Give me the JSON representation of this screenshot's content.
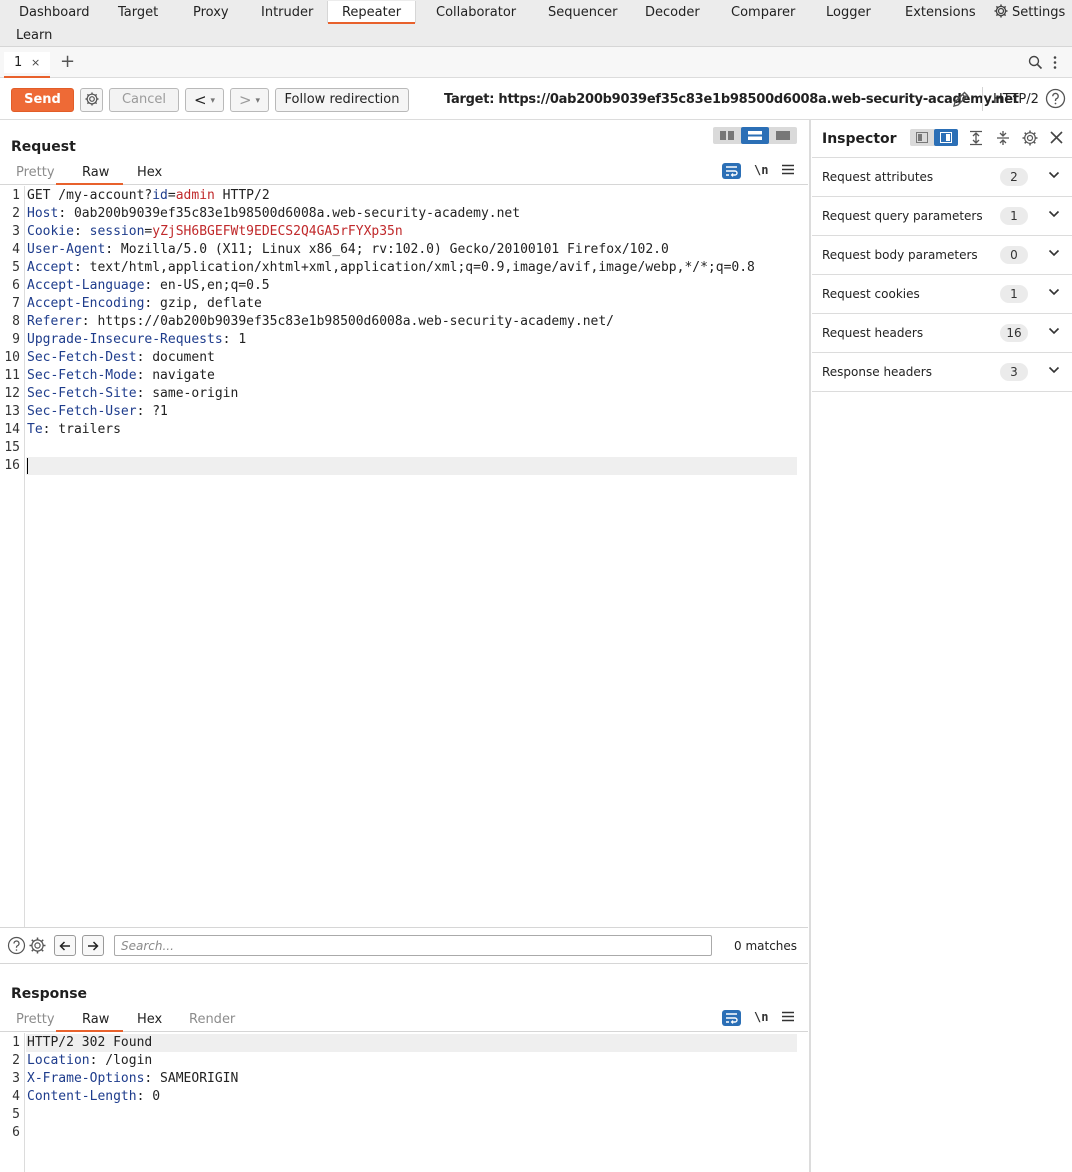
{
  "topnav": {
    "items": [
      "Dashboard",
      "Target",
      "Proxy",
      "Intruder",
      "Repeater",
      "Collaborator",
      "Sequencer",
      "Decoder",
      "Comparer",
      "Logger",
      "Extensions"
    ],
    "active": "Repeater",
    "settings_label": "Settings",
    "learn_label": "Learn",
    "accent_color": "#e8612c"
  },
  "tabs": {
    "items": [
      {
        "label": "1",
        "close": "×"
      }
    ],
    "add_label": "+"
  },
  "toolbar": {
    "send_label": "Send",
    "cancel_label": "Cancel",
    "back_label": "<",
    "forward_label": ">",
    "dropdown_glyph": "▾",
    "follow_label": "Follow redirection",
    "target_label": "Target: https://0ab200b9039ef35c83e1b98500d6008a.web-security-academy.net",
    "http_version": "HTTP/2",
    "send_color": "#ee6a36"
  },
  "request": {
    "title": "Request",
    "tabs": [
      "Pretty",
      "Raw",
      "Hex"
    ],
    "active_tab": "Raw",
    "newline_label": "\\n",
    "lines": [
      [
        {
          "t": "GET /my-account?"
        },
        {
          "t": "id",
          "c": "pk"
        },
        {
          "t": "="
        },
        {
          "t": "admin",
          "c": "pv"
        },
        {
          "t": " HTTP/2"
        }
      ],
      [
        {
          "t": "Host",
          "c": "hk"
        },
        {
          "t": ": 0ab200b9039ef35c83e1b98500d6008a.web-security-academy.net"
        }
      ],
      [
        {
          "t": "Cookie",
          "c": "hk"
        },
        {
          "t": ": "
        },
        {
          "t": "session",
          "c": "pk"
        },
        {
          "t": "="
        },
        {
          "t": "yZjSH6BGEFWt9EDECS2Q4GA5rFYXp35n",
          "c": "pv"
        }
      ],
      [
        {
          "t": "User-Agent",
          "c": "hk"
        },
        {
          "t": ": Mozilla/5.0 (X11; Linux x86_64; rv:102.0) Gecko/20100101 Firefox/102.0"
        }
      ],
      [
        {
          "t": "Accept",
          "c": "hk"
        },
        {
          "t": ": text/html,application/xhtml+xml,application/xml;q=0.9,image/avif,image/webp,*/*;q=0.8"
        }
      ],
      [
        {
          "t": "Accept-Language",
          "c": "hk"
        },
        {
          "t": ": en-US,en;q=0.5"
        }
      ],
      [
        {
          "t": "Accept-Encoding",
          "c": "hk"
        },
        {
          "t": ": gzip, deflate"
        }
      ],
      [
        {
          "t": "Referer",
          "c": "hk"
        },
        {
          "t": ": https://0ab200b9039ef35c83e1b98500d6008a.web-security-academy.net/"
        }
      ],
      [
        {
          "t": "Upgrade-Insecure-Requests",
          "c": "hk"
        },
        {
          "t": ": 1"
        }
      ],
      [
        {
          "t": "Sec-Fetch-Dest",
          "c": "hk"
        },
        {
          "t": ": document"
        }
      ],
      [
        {
          "t": "Sec-Fetch-Mode",
          "c": "hk"
        },
        {
          "t": ": navigate"
        }
      ],
      [
        {
          "t": "Sec-Fetch-Site",
          "c": "hk"
        },
        {
          "t": ": same-origin"
        }
      ],
      [
        {
          "t": "Sec-Fetch-User",
          "c": "hk"
        },
        {
          "t": ": ?1"
        }
      ],
      [
        {
          "t": "Te",
          "c": "hk"
        },
        {
          "t": ": trailers"
        }
      ],
      [],
      []
    ]
  },
  "search": {
    "placeholder": "Search...",
    "value": "",
    "matches": "0 matches"
  },
  "response": {
    "title": "Response",
    "tabs": [
      "Pretty",
      "Raw",
      "Hex",
      "Render"
    ],
    "active_tab": "Raw",
    "newline_label": "\\n",
    "lines": [
      [
        {
          "t": "HTTP/2 302 Found"
        }
      ],
      [
        {
          "t": "Location",
          "c": "hk"
        },
        {
          "t": ": /login"
        }
      ],
      [
        {
          "t": "X-Frame-Options",
          "c": "hk"
        },
        {
          "t": ": SAMEORIGIN"
        }
      ],
      [
        {
          "t": "Content-Length",
          "c": "hk"
        },
        {
          "t": ": 0"
        }
      ],
      [],
      []
    ]
  },
  "inspector": {
    "title": "Inspector",
    "sections": [
      {
        "label": "Request attributes",
        "count": "2"
      },
      {
        "label": "Request query parameters",
        "count": "1"
      },
      {
        "label": "Request body parameters",
        "count": "0"
      },
      {
        "label": "Request cookies",
        "count": "1"
      },
      {
        "label": "Request headers",
        "count": "16"
      },
      {
        "label": "Response headers",
        "count": "3"
      }
    ]
  }
}
